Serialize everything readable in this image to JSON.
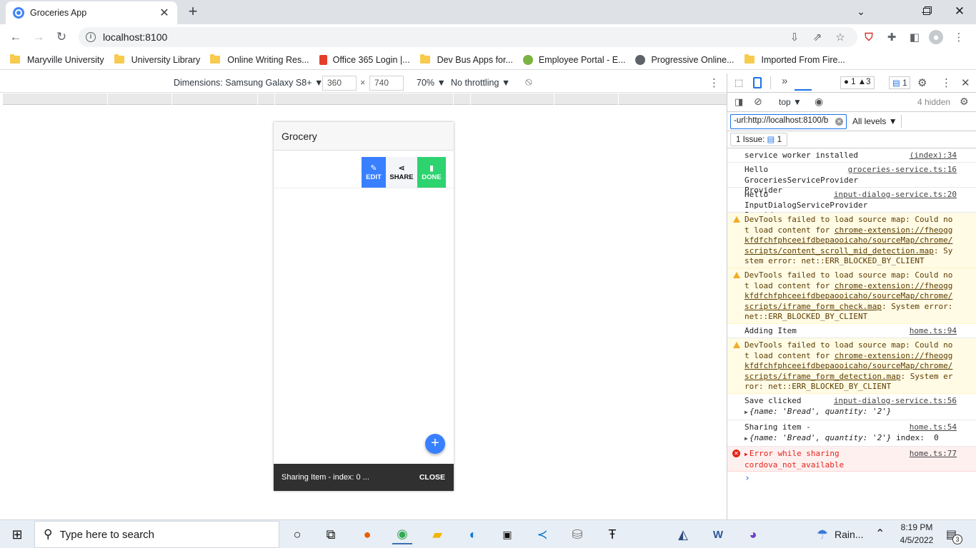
{
  "browser": {
    "tab_title": "Groceries App",
    "url": "localhost:8100",
    "bookmarks": [
      {
        "label": "Maryville University"
      },
      {
        "label": "University Library"
      },
      {
        "label": "Online Writing Res..."
      },
      {
        "label": "Office 365 Login |..."
      },
      {
        "label": "Dev Bus Apps for..."
      },
      {
        "label": "Employee Portal - E..."
      },
      {
        "label": "Progressive Online..."
      },
      {
        "label": "Imported From Fire..."
      }
    ]
  },
  "device_toolbar": {
    "dimensions": "Dimensions: Samsung Galaxy S8+",
    "width": "360",
    "x": "×",
    "height": "740",
    "zoom": "70%",
    "throttling": "No throttling"
  },
  "app": {
    "header_title": "Grocery",
    "options": {
      "edit": "EDIT",
      "share": "SHARE",
      "done": "DONE"
    },
    "fab": "+",
    "toast": {
      "message": "Sharing Item - index: 0 ...",
      "close": "CLOSE"
    },
    "colors": {
      "edit": "#3880ff",
      "share": "#f4f5f8",
      "done": "#2dd36f"
    }
  },
  "devtools": {
    "errors_count": "1",
    "warnings_count": "3",
    "issues_badge": "1",
    "context": "top",
    "hidden": "4 hidden",
    "filter_value": "-url:http://localhost:8100/b",
    "levels": "All levels",
    "issues_label": "1 Issue:",
    "issues_count": "1",
    "messages": [
      {
        "text": "service worker installed",
        "src": "(index):34"
      },
      {
        "text": "Hello GroceriesServiceProvider Provider",
        "src": "groceries-service.ts:16"
      },
      {
        "text": "Hello InputDialogServiceProvider Provider",
        "src": "input-dialog-service.ts:20"
      },
      {
        "pre": "DevTools failed to load source map: Could not load content for ",
        "link": "chrome-extension://fheoggkfdfchfphceeifdbepaooicaho/sourceMap/chrome/scripts/content_scroll_mid_detection.map",
        "post": ": System error: net::ERR_BLOCKED_BY_CLIENT"
      },
      {
        "pre": "DevTools failed to load source map: Could not load content for ",
        "link": "chrome-extension://fheoggkfdfchfphceeifdbepaooicaho/sourceMap/chrome/scripts/iframe_form_check.map",
        "post": ": System error: net::ERR_BLOCKED_BY_CLIENT"
      },
      {
        "text": "Adding Item",
        "src": "home.ts:94"
      },
      {
        "pre": "DevTools failed to load source map: Could not load content for ",
        "link": "chrome-extension://fheoggkfdfchfphceeifdbepaooicaho/sourceMap/chrome/scripts/iframe_form_detection.map",
        "post": ": System error: net::ERR_BLOCKED_BY_CLIENT"
      },
      {
        "text": "Save clicked",
        "src": "input-dialog-service.ts:56",
        "obj": "{name: 'Bread', quantity: '2'}"
      },
      {
        "text": "Sharing item -",
        "src": "home.ts:54",
        "obj": "{name: 'Bread', quantity: '2'}",
        "tail": " index:  0"
      },
      {
        "text": "Error while sharing",
        "src": "home.ts:77",
        "detail": "cordova_not_available"
      }
    ],
    "prompt": "›"
  },
  "taskbar": {
    "search_placeholder": "Type here to search",
    "weather": "Rain...",
    "time": "8:19 PM",
    "date": "4/5/2022",
    "notifications": "3"
  }
}
